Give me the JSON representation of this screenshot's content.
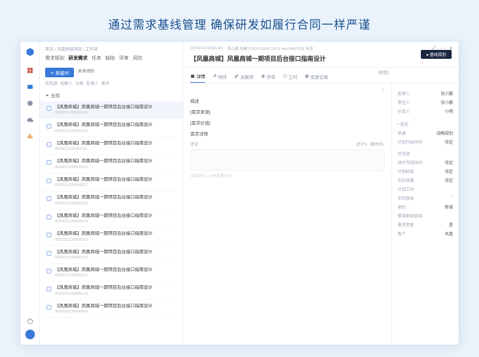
{
  "hero": "通过需求基线管理 确保研发如履行合同一样严谨",
  "breadcrumbs": "首页 › 凤凰商城项目 › 工作项",
  "tabs": {
    "t1": "需求规划",
    "t2": "研发需求",
    "t3": "任务",
    "t4": "缺陷",
    "t5": "评审",
    "t6": "风险"
  },
  "newBtn": "＋ 新建IR",
  "filterLabel": "未关闭的",
  "filters": {
    "f1": "优先级",
    "f2": "创建人",
    "f3": "分类",
    "f4": "处理人",
    "f5": "更多"
  },
  "sectionAll": "全部",
  "items": [
    {
      "title": "【凤凰商城】凤凰商城一期项目后台接口指南设计",
      "id": "IR20221230001421"
    },
    {
      "title": "【凤凰商城】凤凰商城一期项目后台接口指南设计",
      "id": "IR20221230001421"
    },
    {
      "title": "【凤凰商城】凤凰商城一期项目后台接口指南设计",
      "id": "IR20221230001421"
    },
    {
      "title": "【凤凰商城】凤凰商城一期项目后台接口指南设计",
      "id": "IR20221230006019"
    },
    {
      "title": "【凤凰商城】凤凰商城一期项目后台接口指南设计",
      "id": "IR20221230006017"
    },
    {
      "title": "【凤凰商城】凤凰商城一期项目后台接口指南设计",
      "id": "IR20221230006015"
    },
    {
      "title": "【凤凰商城】凤凰商城一期项目后台接口指南设计",
      "id": "IR20221230006014"
    },
    {
      "title": "【凤凰商城】凤凰商城一期项目后台接口指南设计",
      "id": "IR20221230006013"
    },
    {
      "title": "【凤凰商城】凤凰商城一期项目后台接口指南设计",
      "id": "IR20221230006012"
    },
    {
      "title": "【凤凰商城】凤凰商城一期项目后台接口指南设计",
      "id": "IR20221230006011"
    },
    {
      "title": "【凤凰商城】凤凰商城一期项目后台接口指南设计",
      "id": "IR20221230006010"
    },
    {
      "title": "【凤凰商城】凤凰商城一期项目后台接口指南设计",
      "id": "IR20221230006009"
    }
  ],
  "detail": {
    "meta1": "IR20221230001421",
    "meta2": "张小鹏 创建于2022/12/30 10:01 dev-0847分支 标签",
    "title": "【凤凰商城】凤凰商城一期项目后台接口指南设计",
    "baselineBtn": "● 基线规划"
  },
  "dtabs": {
    "t1": "详情",
    "t2": "附件",
    "t3": "关联项",
    "t4": "评审",
    "t5": "工时",
    "t6": "变更记录"
  },
  "sections": {
    "s0": "描述",
    "s1": "[需求来源]",
    "s2": "[需求价值]",
    "s3": "需求详情"
  },
  "collapse": "[收起]",
  "side": {
    "owner_l": "处理人",
    "owner_v": "张小鹏",
    "resp_l": "责任人",
    "resp_v": "张小鹏",
    "assign_l": "抄送人",
    "assign_v": "小明",
    "status_l": "状态",
    "status_v": "",
    "src_l": "来源",
    "src_v": "战略规划",
    "start_l": "计划开始时间",
    "start_v": "待定",
    "priority_l": "优先级",
    "priority_v": "",
    "est_l": "预计完成时间",
    "est_v": "待定",
    "plan_l": "计划结束",
    "plan_v": "待定",
    "actual_l": "实际结果",
    "actual_v": "待定",
    "workh_l": "计划工时",
    "workh_v": "",
    "ver_l": "实际版本",
    "ver_v": "-",
    "cat_l": "类别",
    "cat_v": "新增",
    "impact_l": "需求影响说明",
    "impact_v": "",
    "change_l": "需求变更",
    "change_v": "是",
    "customer_l": "客户",
    "customer_v": "凤凰"
  },
  "comments": {
    "label": "评论",
    "count": "总计0",
    "sort": "按时间↓",
    "empty": "没有评论，点击发表评论"
  }
}
